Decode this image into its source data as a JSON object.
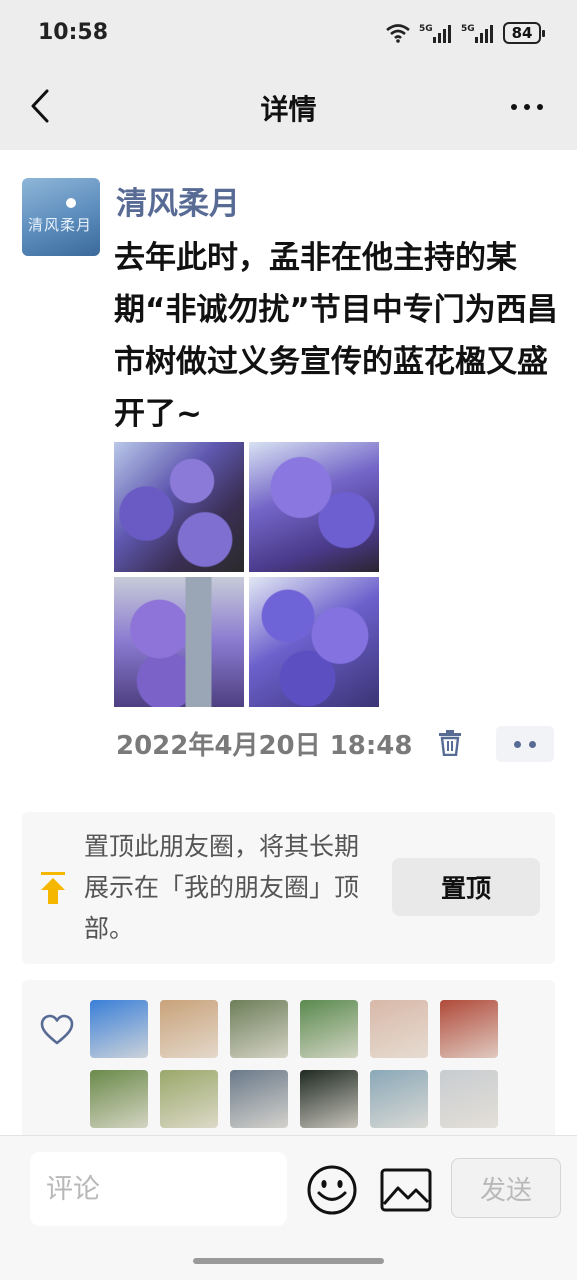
{
  "status_bar": {
    "time": "10:58",
    "signal1": "5G",
    "signal2": "5G",
    "battery": "84"
  },
  "nav": {
    "title": "详情"
  },
  "post": {
    "author": "清风柔月",
    "avatar_text": "清风柔月",
    "text": "去年此时，孟非在他主持的某期“非诚勿扰”节目中专门为西昌市树做过义务宣传的蓝花楹又盛开了~",
    "timestamp": "2022年4月20日 18:48"
  },
  "pin": {
    "text": "置顶此朋友圈，将其长期展示在「我的朋友圈」顶部。",
    "button": "置顶"
  },
  "likes": {
    "avatars": [
      {
        "bg": "#3a7fd8"
      },
      {
        "bg": "#c9a27a"
      },
      {
        "bg": "#6d7f5a"
      },
      {
        "bg": "#5a8a4e"
      },
      {
        "bg": "#d8b8a8"
      },
      {
        "bg": "#b04a3a"
      },
      {
        "bg": "#6a8a4a"
      },
      {
        "bg": "#9aa86a"
      },
      {
        "bg": "#6a7a8a"
      },
      {
        "bg": "#1f2a22"
      },
      {
        "bg": "#8aa8b8"
      },
      {
        "bg": "#c8ccd0"
      }
    ]
  },
  "comment_bar": {
    "placeholder": "评论",
    "send": "发送"
  },
  "colors": {
    "link_blue": "#576b95",
    "pin_arrow": "#f5b700"
  }
}
